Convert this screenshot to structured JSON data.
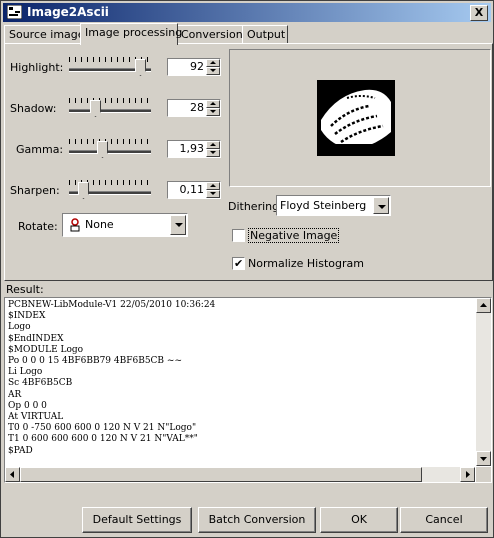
{
  "window": {
    "title": "Image2Ascii",
    "close_label": "X"
  },
  "tabs": [
    {
      "label": "Source image",
      "active": false
    },
    {
      "label": "Image processing",
      "active": true
    },
    {
      "label": "Conversion",
      "active": false
    },
    {
      "label": "Output",
      "active": false
    }
  ],
  "controls": {
    "highlight": {
      "label": "Highlight:",
      "value": "92"
    },
    "shadow": {
      "label": "Shadow:",
      "value": "28"
    },
    "gamma": {
      "label": "Gamma:",
      "value": "1,93"
    },
    "sharpen": {
      "label": "Sharpen:",
      "value": "0,11"
    }
  },
  "rotate": {
    "label": "Rotate:",
    "value": "None"
  },
  "dithering": {
    "label": "Dithering:",
    "value": "Floyd Steinberg"
  },
  "negative_image": {
    "label": "Negative Image",
    "checked": false
  },
  "normalize_histogram": {
    "label": "Normalize Histogram",
    "checked": true
  },
  "result": {
    "label": "Result:",
    "lines": [
      "PCBNEW-LibModule-V1 22/05/2010 10:36:24",
      "$INDEX",
      "Logo",
      "$EndINDEX",
      "$MODULE Logo",
      "Po 0 0 0 15 4BF6BB79 4BF6B5CB ~~",
      "Li Logo",
      "Sc 4BF6B5CB",
      "AR",
      "Op 0 0 0",
      "At VIRTUAL",
      "T0 0 -750 600 600 0 120 N V 21 N\"Logo\"",
      "T1 0 600 600 600 0 120 N V 21 N\"VAL**\"",
      "$PAD"
    ]
  },
  "buttons": {
    "default_settings": "Default Settings",
    "batch_conversion": "Batch Conversion",
    "ok": "OK",
    "cancel": "Cancel"
  }
}
